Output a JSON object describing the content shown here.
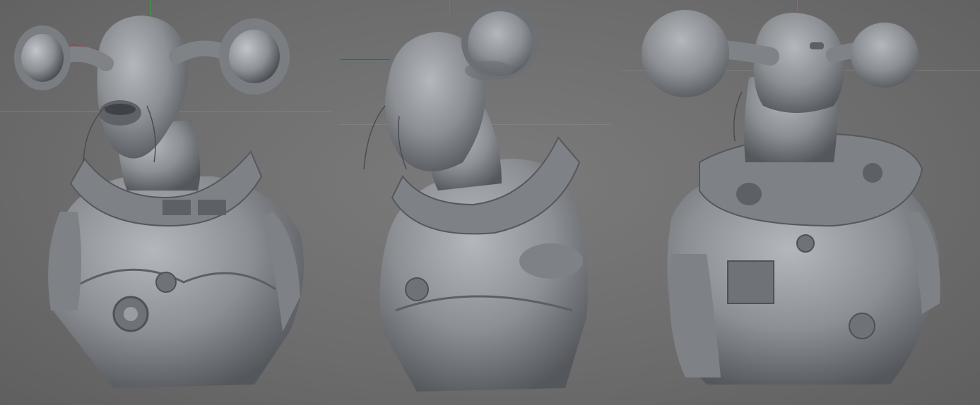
{
  "app": {
    "type": "3d-sculpt-viewport-comparison"
  },
  "viewports": [
    {
      "id": "front",
      "model": "alien-bust-front-view"
    },
    {
      "id": "three-quarter",
      "model": "alien-bust-three-quarter-view"
    },
    {
      "id": "back",
      "model": "alien-bust-back-view"
    }
  ],
  "colors": {
    "background": "#6f6f6f",
    "clay": "#8c8f94",
    "clay_shadow": "#54575c",
    "clay_highlight": "#b4b7bc",
    "axis_y": "#39a13a",
    "axis_x": "#b12e2e",
    "grid_line": "#8a8a8a"
  }
}
